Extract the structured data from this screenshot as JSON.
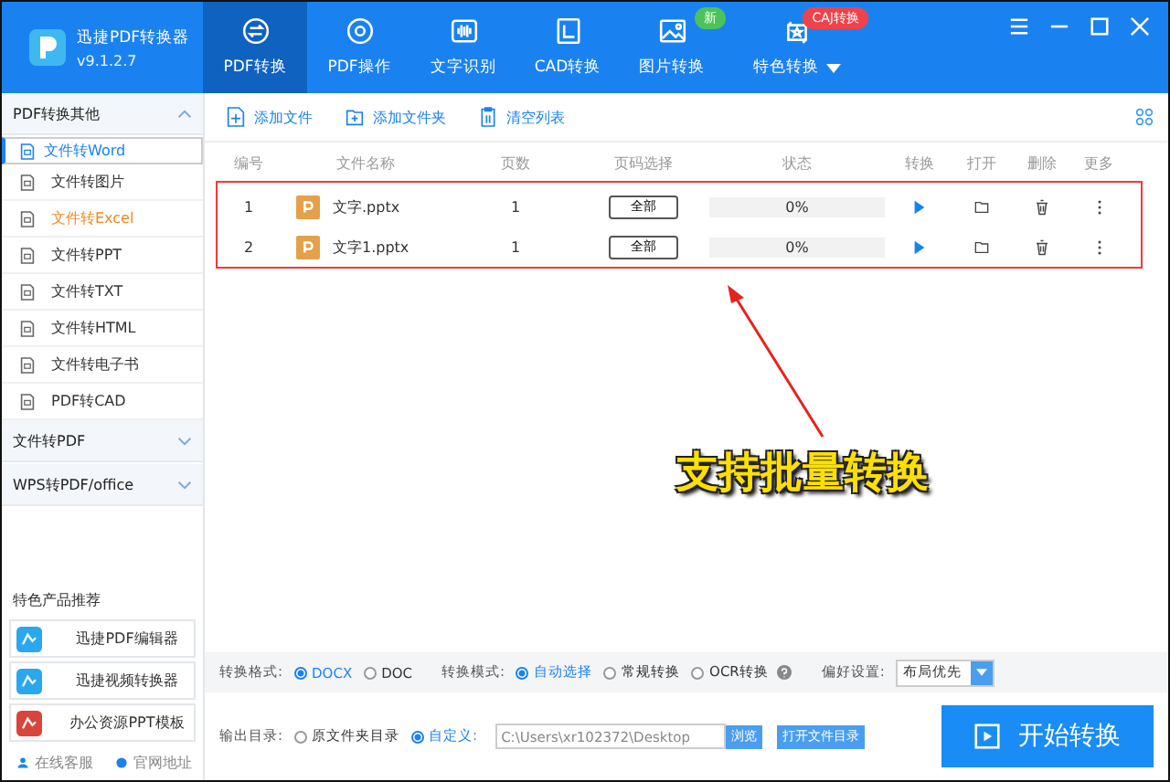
{
  "app": {
    "name": "迅捷PDF转换器",
    "version": "v9.1.2.7"
  },
  "nav_tabs": [
    {
      "label": "PDF转换",
      "selected": true,
      "dropdown": false
    },
    {
      "label": "PDF操作",
      "selected": false,
      "dropdown": false
    },
    {
      "label": "文字识别",
      "selected": false,
      "dropdown": false
    },
    {
      "label": "CAD转换",
      "selected": false,
      "dropdown": false
    },
    {
      "label": "图片转换",
      "selected": false,
      "badge": {
        "text": "新",
        "color": "#4cc35a"
      },
      "dropdown": false
    },
    {
      "label": "特色转换",
      "selected": false,
      "badge": {
        "text": "CAJ转换",
        "color": "#f0424a"
      },
      "dropdown": true
    }
  ],
  "sidebar": {
    "groups": [
      {
        "title": "PDF转换其他",
        "expanded": true,
        "items": [
          {
            "label": "文件转Word",
            "selected": true,
            "hovered": false
          },
          {
            "label": "文件转图片",
            "selected": false,
            "hovered": false
          },
          {
            "label": "文件转Excel",
            "selected": false,
            "hovered": true
          },
          {
            "label": "文件转PPT",
            "selected": false,
            "hovered": false
          },
          {
            "label": "文件转TXT",
            "selected": false,
            "hovered": false
          },
          {
            "label": "文件转HTML",
            "selected": false,
            "hovered": false
          },
          {
            "label": "文件转电子书",
            "selected": false,
            "hovered": false
          },
          {
            "label": "PDF转CAD",
            "selected": false,
            "hovered": false
          }
        ]
      },
      {
        "title": "文件转PDF",
        "expanded": false
      },
      {
        "title": "WPS转PDF/office",
        "expanded": false
      }
    ],
    "promo_title": "特色产品推荐",
    "promos": [
      "迅捷PDF编辑器",
      "迅捷视频转换器",
      "办公资源PPT模板"
    ],
    "links": [
      "在线客服",
      "官网地址"
    ]
  },
  "toolbar": [
    "添加文件",
    "添加文件夹",
    "清空列表"
  ],
  "table": {
    "columns": [
      "编号",
      "文件名称",
      "页数",
      "页码选择",
      "状态",
      "转换",
      "打开",
      "删除",
      "更多"
    ],
    "rows": [
      {
        "index": "1",
        "name": "文字.pptx",
        "pages": "1",
        "page_select": "全部",
        "status": "0%"
      },
      {
        "index": "2",
        "name": "文字1.pptx",
        "pages": "1",
        "page_select": "全部",
        "status": "0%"
      }
    ]
  },
  "annotation": {
    "text": "支持批量转换"
  },
  "options": {
    "format_label": "转换格式:",
    "formats": [
      {
        "label": "DOCX",
        "selected": true
      },
      {
        "label": "DOC",
        "selected": false
      }
    ],
    "mode_label": "转换模式:",
    "modes": [
      {
        "label": "自动选择",
        "selected": true,
        "help": false
      },
      {
        "label": "常规转换",
        "selected": false,
        "help": false
      },
      {
        "label": "OCR转换",
        "selected": false,
        "help": true
      }
    ],
    "pref_label": "偏好设置:",
    "pref_value": "布局优先"
  },
  "output": {
    "label": "输出目录:",
    "choices": [
      {
        "label": "原文件夹目录",
        "selected": false
      },
      {
        "label": "自定义:",
        "selected": true
      }
    ],
    "path": "C:\\Users\\xr102372\\Desktop",
    "browse": "浏览",
    "open_folder": "打开文件目录"
  },
  "start_button": "开始转换"
}
